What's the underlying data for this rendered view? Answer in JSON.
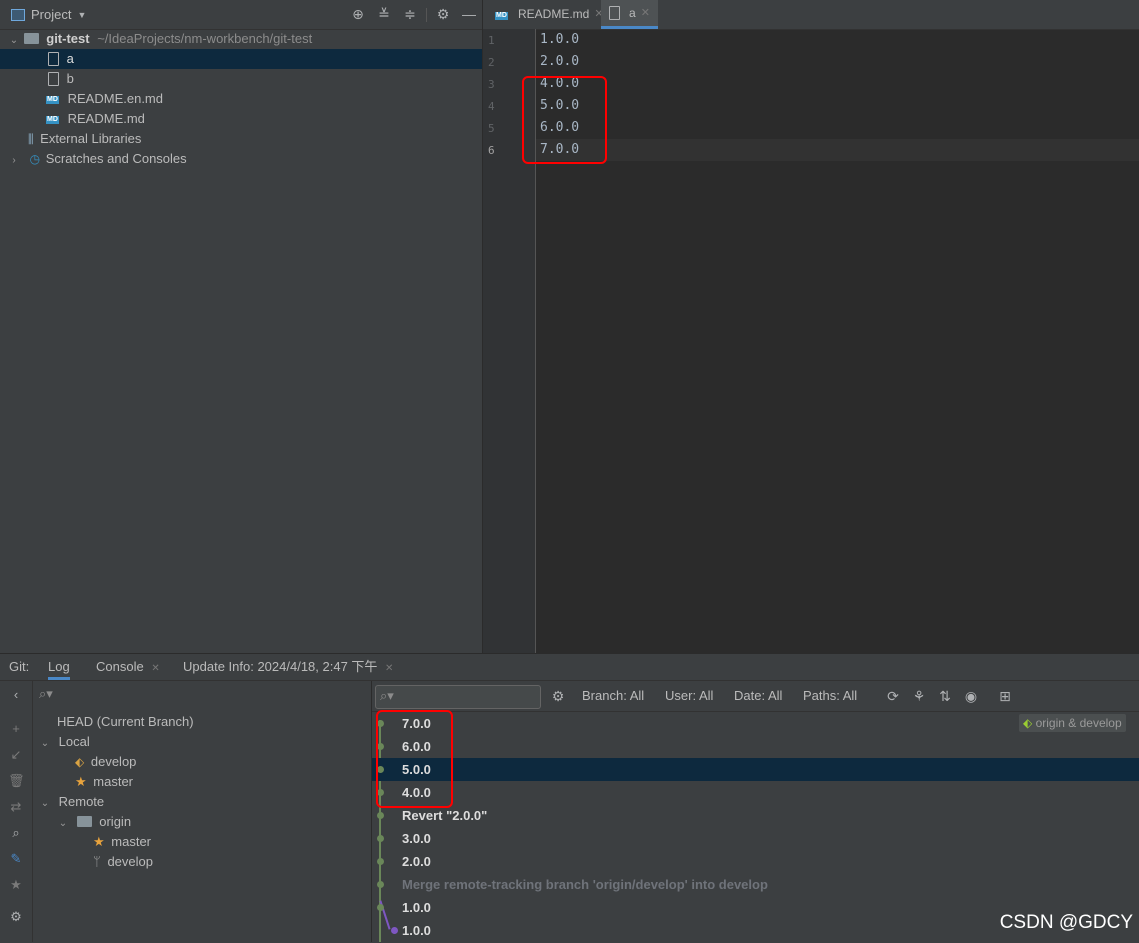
{
  "project": {
    "title": "Project",
    "tree": [
      {
        "label": "git-test",
        "path": "~/IdeaProjects/nm-workbench/git-test"
      },
      {
        "label": "a"
      },
      {
        "label": "b"
      },
      {
        "label": "README.en.md"
      },
      {
        "label": "README.md"
      },
      {
        "label": "External Libraries"
      },
      {
        "label": "Scratches and Consoles"
      }
    ]
  },
  "editor": {
    "tabs": [
      {
        "label": "README.md",
        "icon": "markdown-file-icon"
      },
      {
        "label": "a",
        "icon": "text-file-icon"
      }
    ],
    "line_numbers": [
      "1",
      "2",
      "3",
      "4",
      "5",
      "6"
    ],
    "lines": [
      "1.0.0",
      "2.0.0",
      "4.0.0",
      "5.0.0",
      "6.0.0",
      "7.0.0"
    ]
  },
  "bottom": {
    "tool_label": "Git:",
    "tabs": [
      {
        "label": "Log"
      },
      {
        "label": "Console"
      },
      {
        "label": "Update Info: 2024/4/18, 2:47 下午"
      }
    ]
  },
  "branches": {
    "head": "HEAD (Current Branch)",
    "local": "Local",
    "local_items": [
      "develop",
      "master"
    ],
    "remote": "Remote",
    "remote_group": "origin",
    "remote_items": [
      "master",
      "develop"
    ]
  },
  "log": {
    "filters": {
      "branch": "Branch: All",
      "user": "User: All",
      "date": "Date: All",
      "paths": "Paths: All"
    },
    "ref_label": "origin & develop",
    "commits": [
      "7.0.0",
      "6.0.0",
      "5.0.0",
      "4.0.0",
      "Revert \"2.0.0\"",
      "3.0.0",
      "2.0.0",
      "Merge remote-tracking branch 'origin/develop' into develop",
      "1.0.0",
      "1.0.0"
    ]
  },
  "watermark": "CSDN @GDCY",
  "colors": {
    "accent": "#4a88c7",
    "selection": "#0d293e",
    "highlight_box": "#ff0000",
    "graph_green": "#6a8759",
    "graph_purple": "#7e57c2"
  }
}
